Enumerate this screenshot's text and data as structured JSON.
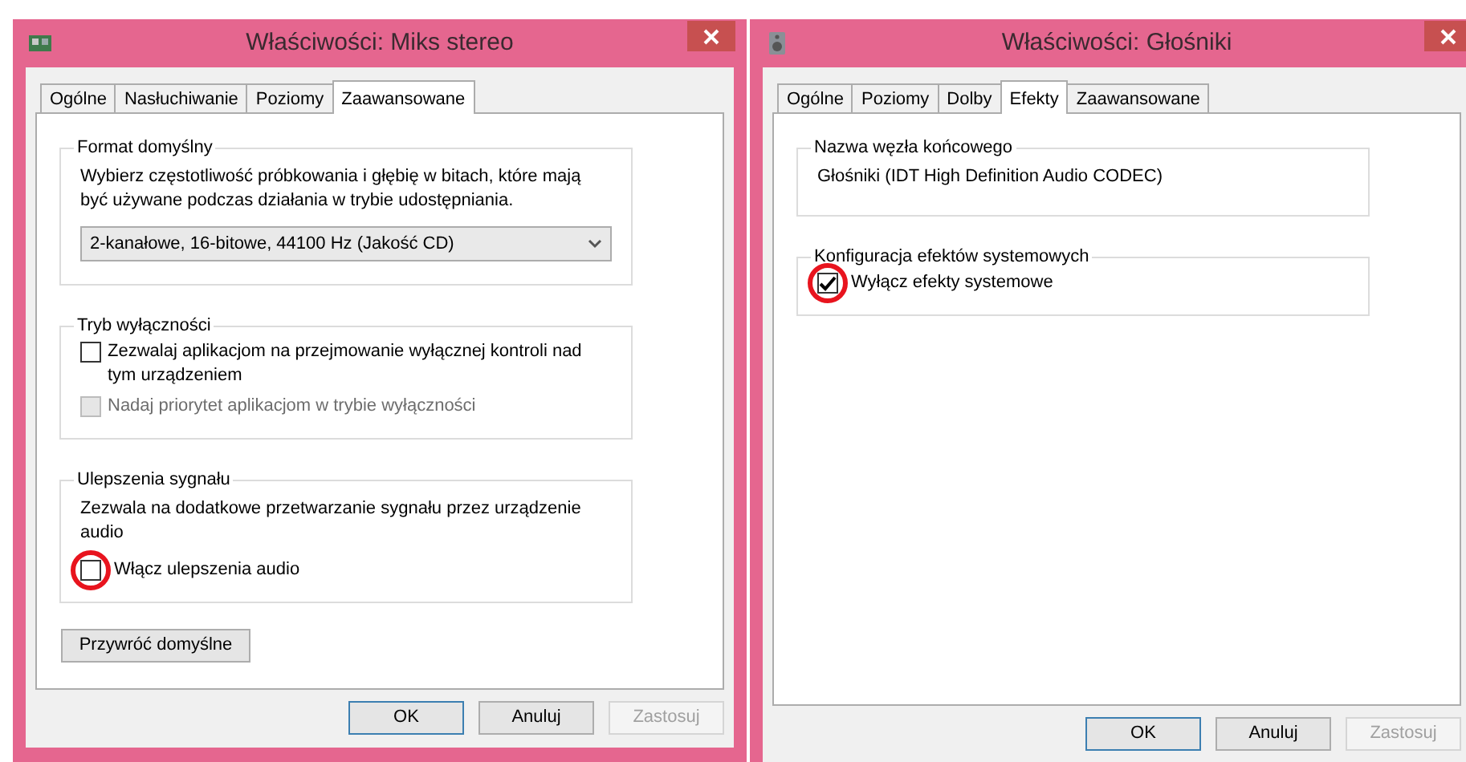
{
  "windows": [
    {
      "title": "Właściwości: Miks stereo",
      "tabs": [
        {
          "label": "Ogólne",
          "selected": false
        },
        {
          "label": "Nasłuchiwanie",
          "selected": false
        },
        {
          "label": "Poziomy",
          "selected": false
        },
        {
          "label": "Zaawansowane",
          "selected": true
        }
      ],
      "groups": [
        {
          "title": "Format domyślny",
          "items": [
            {
              "kind": "text",
              "text": "Wybierz częstotliwość próbkowania i głębię w bitach, które mają być używane podczas działania w trybie udostępniania."
            },
            {
              "kind": "select",
              "value": "2-kanałowe, 16-bitowe, 44100 Hz (Jakość CD)"
            }
          ]
        },
        {
          "title": "Tryb wyłączności",
          "items": [
            {
              "kind": "checkbox",
              "label": "Zezwalaj aplikacjom na przejmowanie wyłącznej kontroli nad tym urządzeniem",
              "checked": false,
              "disabled": false,
              "circled": false
            },
            {
              "kind": "checkbox",
              "label": "Nadaj priorytet aplikacjom w trybie wyłączności",
              "checked": false,
              "disabled": true,
              "circled": false
            }
          ]
        },
        {
          "title": "Ulepszenia sygnału",
          "items": [
            {
              "kind": "text",
              "text": "Zezwala na dodatkowe przetwarzanie sygnału przez urządzenie audio"
            },
            {
              "kind": "checkbox",
              "label": "Włącz ulepszenia audio",
              "checked": false,
              "disabled": false,
              "circled": true
            }
          ]
        }
      ],
      "restore_button": "Przywróć domyślne",
      "buttons": [
        {
          "label": "OK",
          "default": true,
          "disabled": false
        },
        {
          "label": "Anuluj",
          "default": false,
          "disabled": false
        },
        {
          "label": "Zastosuj",
          "default": false,
          "disabled": true
        }
      ]
    },
    {
      "title": "Właściwości: Głośniki",
      "tabs": [
        {
          "label": "Ogólne",
          "selected": false
        },
        {
          "label": "Poziomy",
          "selected": false
        },
        {
          "label": "Dolby",
          "selected": false
        },
        {
          "label": "Efekty",
          "selected": true
        },
        {
          "label": "Zaawansowane",
          "selected": false
        }
      ],
      "groups": [
        {
          "title": "Nazwa węzła końcowego",
          "items": [
            {
              "kind": "text",
              "text": "Głośniki (IDT High Definition Audio CODEC)"
            }
          ]
        },
        {
          "title": "Konfiguracja efektów systemowych",
          "items": [
            {
              "kind": "checkbox",
              "label": "Wyłącz efekty systemowe",
              "checked": true,
              "disabled": false,
              "circled": true
            }
          ]
        }
      ],
      "buttons": [
        {
          "label": "OK",
          "default": true,
          "disabled": false
        },
        {
          "label": "Anuluj",
          "default": false,
          "disabled": false
        },
        {
          "label": "Zastosuj",
          "default": false,
          "disabled": true
        }
      ]
    }
  ]
}
